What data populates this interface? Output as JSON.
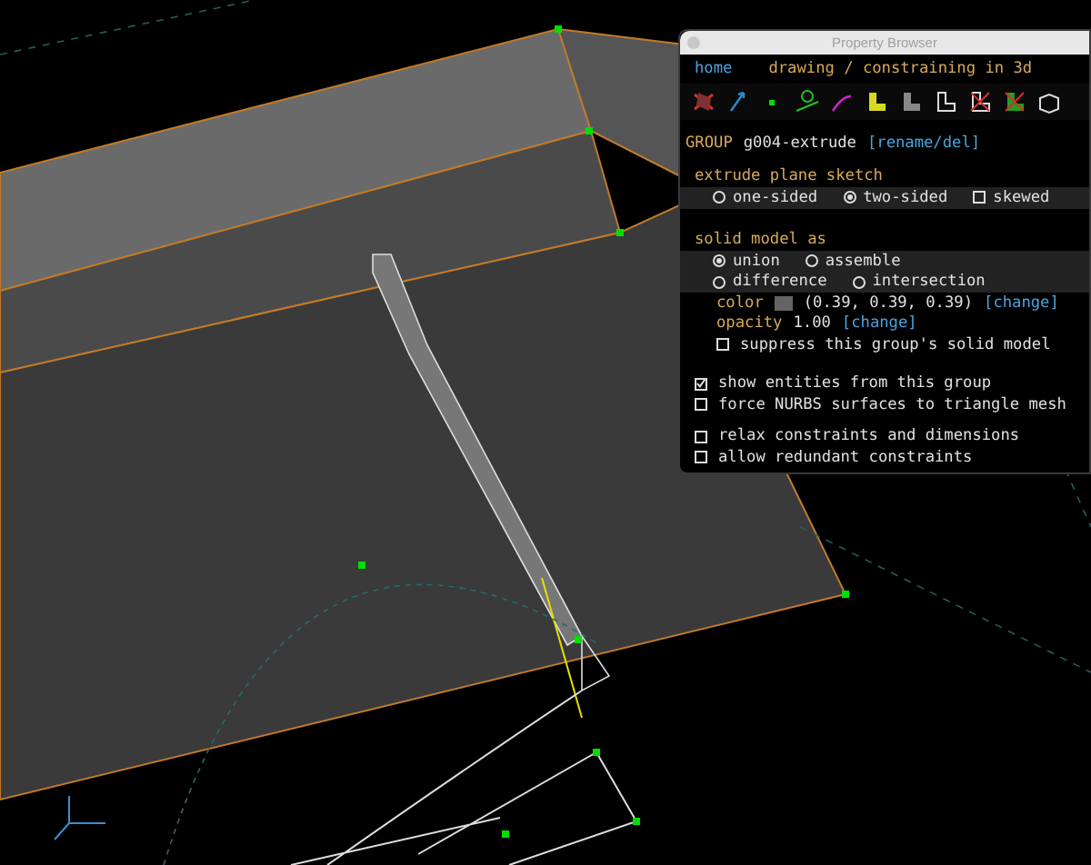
{
  "window": {
    "title": "Property Browser"
  },
  "nav": {
    "home": "home",
    "breadcrumb": "drawing / constraining in 3d"
  },
  "group": {
    "label": "GROUP",
    "name": "g004-extrude",
    "link": "[rename/del]"
  },
  "extrude": {
    "title": "extrude plane sketch",
    "options": [
      {
        "label": "one-sided",
        "kind": "radio",
        "selected": false
      },
      {
        "label": "two-sided",
        "kind": "radio",
        "selected": true
      },
      {
        "label": "skewed",
        "kind": "checkbox",
        "selected": false
      }
    ]
  },
  "solid": {
    "title": "solid model as",
    "rows": [
      [
        {
          "label": "union",
          "selected": true
        },
        {
          "label": "assemble",
          "selected": false
        }
      ],
      [
        {
          "label": "difference",
          "selected": false
        },
        {
          "label": "intersection",
          "selected": false
        }
      ]
    ],
    "color": {
      "label": "color",
      "color": "#646464",
      "value": "(0.39, 0.39, 0.39)",
      "link": "[change]"
    },
    "opacity": {
      "label": "opacity",
      "value": "1.00",
      "link": "[change]"
    },
    "suppress": {
      "label": "suppress this group's solid model",
      "checked": false
    }
  },
  "toggles": [
    [
      {
        "label": "show entities from this group",
        "checked": true
      },
      {
        "label": "force NURBS surfaces to triangle mesh",
        "checked": false
      }
    ],
    [
      {
        "label": "relax constraints and dimensions",
        "checked": false
      },
      {
        "label": "allow redundant constraints",
        "checked": false
      }
    ]
  ]
}
